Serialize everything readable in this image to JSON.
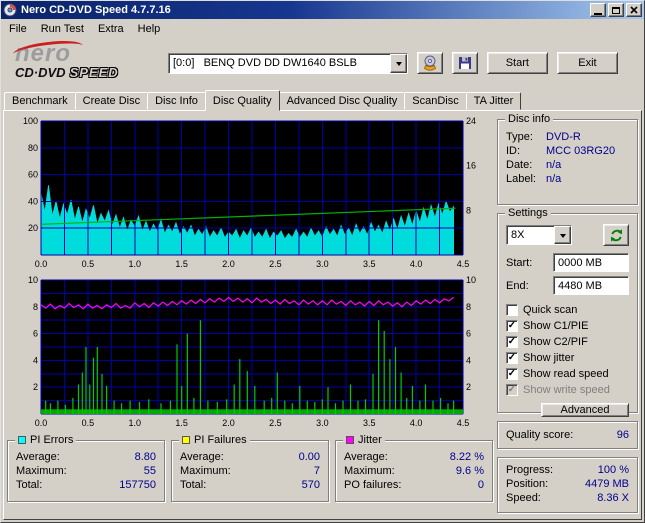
{
  "window": {
    "title": "Nero CD-DVD Speed 4.7.7.16"
  },
  "menu": {
    "items": [
      "File",
      "Run Test",
      "Extra",
      "Help"
    ]
  },
  "logo": {
    "nero": "nero",
    "cddvd": "CD·DVD",
    "speed": "SPEED"
  },
  "toolbar": {
    "drive": "[0:0]   BENQ DVD DD DW1640 BSLB",
    "start": "Start",
    "exit": "Exit"
  },
  "tabs": {
    "items": [
      "Benchmark",
      "Create Disc",
      "Disc Info",
      "Disc Quality",
      "Advanced Disc Quality",
      "ScanDisc",
      "TA Jitter"
    ],
    "active": "Disc Quality"
  },
  "disc_info": {
    "title": "Disc info",
    "rows": [
      [
        "Type:",
        "DVD-R"
      ],
      [
        "ID:",
        "MCC 03RG20"
      ],
      [
        "Date:",
        "n/a"
      ],
      [
        "Label:",
        "n/a"
      ]
    ]
  },
  "settings": {
    "title": "Settings",
    "speed": "8X",
    "start_label": "Start:",
    "start_value": "0000 MB",
    "end_label": "End:",
    "end_value": "4480 MB",
    "checkboxes": [
      {
        "label": "Quick scan",
        "checked": false,
        "disabled": false
      },
      {
        "label": "Show C1/PIE",
        "checked": true,
        "disabled": false
      },
      {
        "label": "Show C2/PIF",
        "checked": true,
        "disabled": false
      },
      {
        "label": "Show jitter",
        "checked": true,
        "disabled": false
      },
      {
        "label": "Show read speed",
        "checked": true,
        "disabled": false
      },
      {
        "label": "Show write speed",
        "checked": true,
        "disabled": true
      }
    ],
    "advanced": "Advanced"
  },
  "quality": {
    "label": "Quality score:",
    "value": "96"
  },
  "progress": {
    "rows": [
      [
        "Progress:",
        "100 %"
      ],
      [
        "Position:",
        "4479 MB"
      ],
      [
        "Speed:",
        "8.36 X"
      ]
    ]
  },
  "stats": {
    "boxes": [
      {
        "title": "PI Errors",
        "chip_color": "#00ffff",
        "rows": [
          [
            "Average:",
            "8.80"
          ],
          [
            "Maximum:",
            "55"
          ],
          [
            "Total:",
            "157750"
          ]
        ]
      },
      {
        "title": "PI Failures",
        "chip_color": "#ffff00",
        "rows": [
          [
            "Average:",
            "0.00"
          ],
          [
            "Maximum:",
            "7"
          ],
          [
            "Total:",
            "570"
          ]
        ]
      },
      {
        "title": "Jitter",
        "chip_color": "#ff00ff",
        "rows": [
          [
            "Average:",
            "8.22 %"
          ],
          [
            "Maximum:",
            "9.6 %"
          ],
          [
            "PO failures:",
            "0"
          ]
        ]
      }
    ]
  },
  "icons": {
    "check": "✓"
  },
  "chart_data": [
    {
      "type": "area+line",
      "name": "pi_errors_and_read_speed",
      "bg": "#000000",
      "grid_color": "#0000aa",
      "xlim": [
        0,
        4.5
      ],
      "x_grid": 0.25,
      "ylim": [
        0,
        100
      ],
      "y_grid": 20,
      "yticks_left": [
        20,
        40,
        60,
        80,
        100
      ],
      "yticks_right": [
        {
          "v": 33.3,
          "label": "8"
        },
        {
          "v": 66.7,
          "label": "16"
        },
        {
          "v": 100,
          "label": "24"
        }
      ],
      "xticks": [
        "0.0",
        "0.5",
        "1.0",
        "1.5",
        "2.0",
        "2.5",
        "3.0",
        "3.5",
        "4.0",
        "4.5"
      ],
      "series": [
        {
          "type": "area",
          "name": "pi_errors",
          "color": "#00dcdc",
          "x_start": 0,
          "x_step": 0.04,
          "values": [
            46,
            32,
            52,
            29,
            40,
            27,
            38,
            30,
            41,
            26,
            36,
            24,
            34,
            27,
            37,
            23,
            31,
            25,
            33,
            22,
            30,
            20,
            28,
            18,
            26,
            21,
            29,
            18,
            25,
            17,
            23,
            18,
            26,
            16,
            22,
            17,
            24,
            15,
            21,
            16,
            22,
            14,
            19,
            15,
            21,
            13,
            18,
            14,
            20,
            13,
            17,
            14,
            19,
            12,
            18,
            14,
            20,
            13,
            17,
            13,
            19,
            12,
            17,
            14,
            18,
            12,
            16,
            13,
            19,
            13,
            17,
            13,
            20,
            14,
            18,
            13,
            21,
            15,
            19,
            14,
            22,
            15,
            20,
            14,
            23,
            16,
            21,
            15,
            24,
            17,
            22,
            16,
            25,
            18,
            27,
            19,
            29,
            21,
            31,
            22,
            33,
            24,
            35,
            26,
            37,
            28,
            38,
            30,
            40,
            32,
            36
          ]
        },
        {
          "type": "grid"
        },
        {
          "type": "line",
          "name": "read_speed",
          "color": "#00b400",
          "points": [
            [
              0,
              22.9
            ],
            [
              4.42,
              34.9
            ]
          ]
        }
      ]
    },
    {
      "type": "spikes+line",
      "name": "pi_failures_and_jitter",
      "bg": "#000000",
      "grid_color": "#0000aa",
      "xlim": [
        0,
        4.5
      ],
      "x_grid": 0.25,
      "ylim": [
        0,
        10
      ],
      "y_grid": 1,
      "yticks_left": [
        2,
        4,
        6,
        8,
        10
      ],
      "yticks_right": [
        {
          "v": 2,
          "label": "2"
        },
        {
          "v": 4,
          "label": "4"
        },
        {
          "v": 6,
          "label": "6"
        },
        {
          "v": 8,
          "label": "8"
        },
        {
          "v": 10,
          "label": "10"
        }
      ],
      "xticks": [
        "0.0",
        "0.5",
        "1.0",
        "1.5",
        "2.0",
        "2.5",
        "3.0",
        "3.5",
        "4.0",
        "4.5"
      ],
      "series": [
        {
          "type": "grid"
        },
        {
          "type": "strip",
          "name": "pi_failures_baseline",
          "color": "#00aa00",
          "height": 0.35
        },
        {
          "type": "spikes",
          "name": "pi_failures",
          "color": "#00cc00",
          "points": [
            [
              0.05,
              1
            ],
            [
              0.1,
              0.8
            ],
            [
              0.18,
              1
            ],
            [
              0.26,
              0.7
            ],
            [
              0.34,
              1.2
            ],
            [
              0.4,
              2.2
            ],
            [
              0.44,
              3.1
            ],
            [
              0.48,
              5
            ],
            [
              0.52,
              2.2
            ],
            [
              0.56,
              4.2
            ],
            [
              0.6,
              5
            ],
            [
              0.65,
              3
            ],
            [
              0.7,
              2.1
            ],
            [
              0.78,
              1
            ],
            [
              0.86,
              0.8
            ],
            [
              0.95,
              1
            ],
            [
              1.05,
              0.9
            ],
            [
              1.15,
              1.1
            ],
            [
              1.28,
              0.8
            ],
            [
              1.38,
              1
            ],
            [
              1.45,
              5.2
            ],
            [
              1.5,
              2.1
            ],
            [
              1.56,
              6
            ],
            [
              1.63,
              1.2
            ],
            [
              1.7,
              7
            ],
            [
              1.78,
              1
            ],
            [
              1.88,
              0.9
            ],
            [
              1.98,
              1.1
            ],
            [
              2.06,
              2.2
            ],
            [
              2.12,
              4.1
            ],
            [
              2.2,
              3.2
            ],
            [
              2.28,
              2.1
            ],
            [
              2.38,
              1
            ],
            [
              2.46,
              1.2
            ],
            [
              2.52,
              3.1
            ],
            [
              2.6,
              1
            ],
            [
              2.68,
              0.8
            ],
            [
              2.76,
              2.1
            ],
            [
              2.84,
              1
            ],
            [
              2.92,
              0.9
            ],
            [
              3.0,
              1.1
            ],
            [
              3.06,
              2
            ],
            [
              3.14,
              0.8
            ],
            [
              3.22,
              1
            ],
            [
              3.3,
              2.2
            ],
            [
              3.38,
              1
            ],
            [
              3.46,
              1.1
            ],
            [
              3.54,
              3
            ],
            [
              3.6,
              7
            ],
            [
              3.66,
              6.2
            ],
            [
              3.72,
              4.1
            ],
            [
              3.78,
              5
            ],
            [
              3.84,
              3.1
            ],
            [
              3.9,
              1.2
            ],
            [
              3.96,
              2.1
            ],
            [
              4.04,
              1
            ],
            [
              4.1,
              2.2
            ],
            [
              4.18,
              1
            ],
            [
              4.26,
              1.2
            ],
            [
              4.34,
              0.8
            ],
            [
              4.4,
              1
            ]
          ]
        },
        {
          "type": "line",
          "name": "jitter",
          "color": "#ff00ff",
          "x_start": 0,
          "x_step": 0.05,
          "values": [
            8.15,
            7.9,
            8.2,
            7.85,
            8.1,
            7.9,
            8.25,
            7.95,
            8.15,
            7.85,
            8.2,
            7.9,
            8.1,
            7.85,
            8.15,
            7.95,
            8.25,
            7.9,
            8.1,
            7.9,
            8.3,
            8.0,
            8.25,
            7.95,
            8.3,
            8.05,
            8.35,
            8.1,
            8.4,
            8.15,
            8.45,
            8.2,
            8.5,
            8.25,
            8.55,
            8.3,
            8.6,
            8.35,
            8.65,
            8.4,
            8.7,
            8.4,
            8.65,
            8.35,
            8.6,
            8.3,
            8.65,
            8.35,
            8.55,
            8.25,
            8.5,
            8.2,
            8.55,
            8.25,
            8.45,
            8.15,
            8.5,
            8.2,
            8.45,
            8.15,
            8.45,
            8.15,
            8.5,
            8.2,
            8.4,
            8.1,
            8.45,
            8.15,
            8.35,
            8.05,
            8.4,
            8.1,
            8.45,
            8.15,
            8.35,
            8.05,
            8.3,
            8.0,
            8.35,
            8.1,
            8.45,
            8.2,
            8.5,
            8.25,
            8.55,
            8.3,
            8.6,
            8.45,
            8.7
          ]
        }
      ]
    }
  ]
}
